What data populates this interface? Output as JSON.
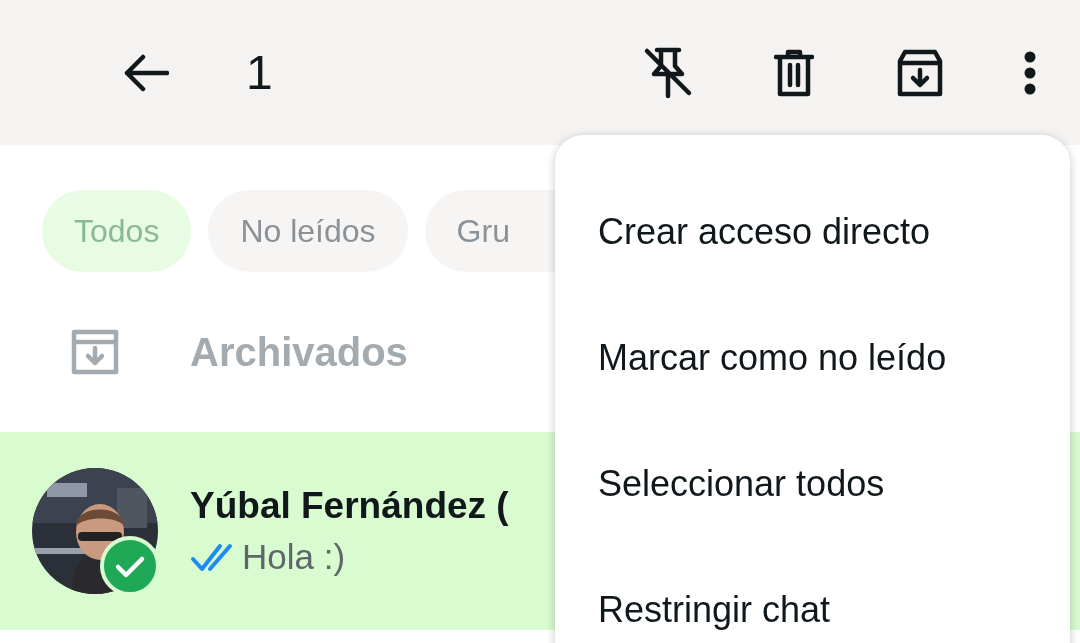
{
  "top_bar": {
    "selection_count": "1"
  },
  "filters": [
    {
      "label": "Todos",
      "selected": true
    },
    {
      "label": "No leídos",
      "selected": false
    },
    {
      "label": "Gru",
      "selected": false
    }
  ],
  "archived": {
    "label": "Archivados"
  },
  "chats": [
    {
      "name": "Yúbal Fernández (",
      "message": "Hola :)",
      "selected": true,
      "read": true
    }
  ],
  "menu": {
    "items": [
      "Crear acceso directo",
      "Marcar como no leído",
      "Seleccionar todos",
      "Restringir chat"
    ]
  }
}
